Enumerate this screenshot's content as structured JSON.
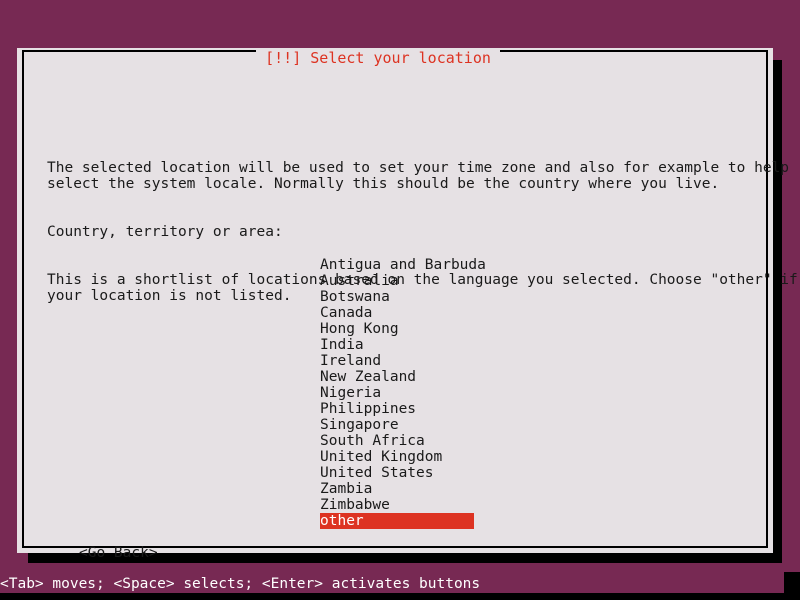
{
  "screen": {
    "background_color": "#772953",
    "shadow_color": "#000000"
  },
  "dialog": {
    "title": "[!!] Select your location",
    "title_color": "#dd3322",
    "background_color": "#e6e1e4",
    "border_color": "#000000",
    "paragraphs": [
      "The selected location will be used to set your time zone and also for example to help\nselect the system locale. Normally this should be the country where you live.",
      "This is a shortlist of locations based on the language you selected. Choose \"other\" if\nyour location is not listed."
    ],
    "prompt_label": "Country, territory or area:",
    "list": {
      "items": [
        "Antigua and Barbuda",
        "Australia",
        "Botswana",
        "Canada",
        "Hong Kong",
        "India",
        "Ireland",
        "New Zealand",
        "Nigeria",
        "Philippines",
        "Singapore",
        "South Africa",
        "United Kingdom",
        "United States",
        "Zambia",
        "Zimbabwe",
        "other"
      ],
      "selected_index": 16,
      "selected_value": "other",
      "highlight_color": "#dd3322",
      "highlight_text_color": "#ffffff"
    },
    "buttons": {
      "go_back": "<Go Back>"
    }
  },
  "status_bar": {
    "text": "<Tab> moves; <Space> selects; <Enter> activates buttons",
    "text_color": "#ffffff"
  }
}
